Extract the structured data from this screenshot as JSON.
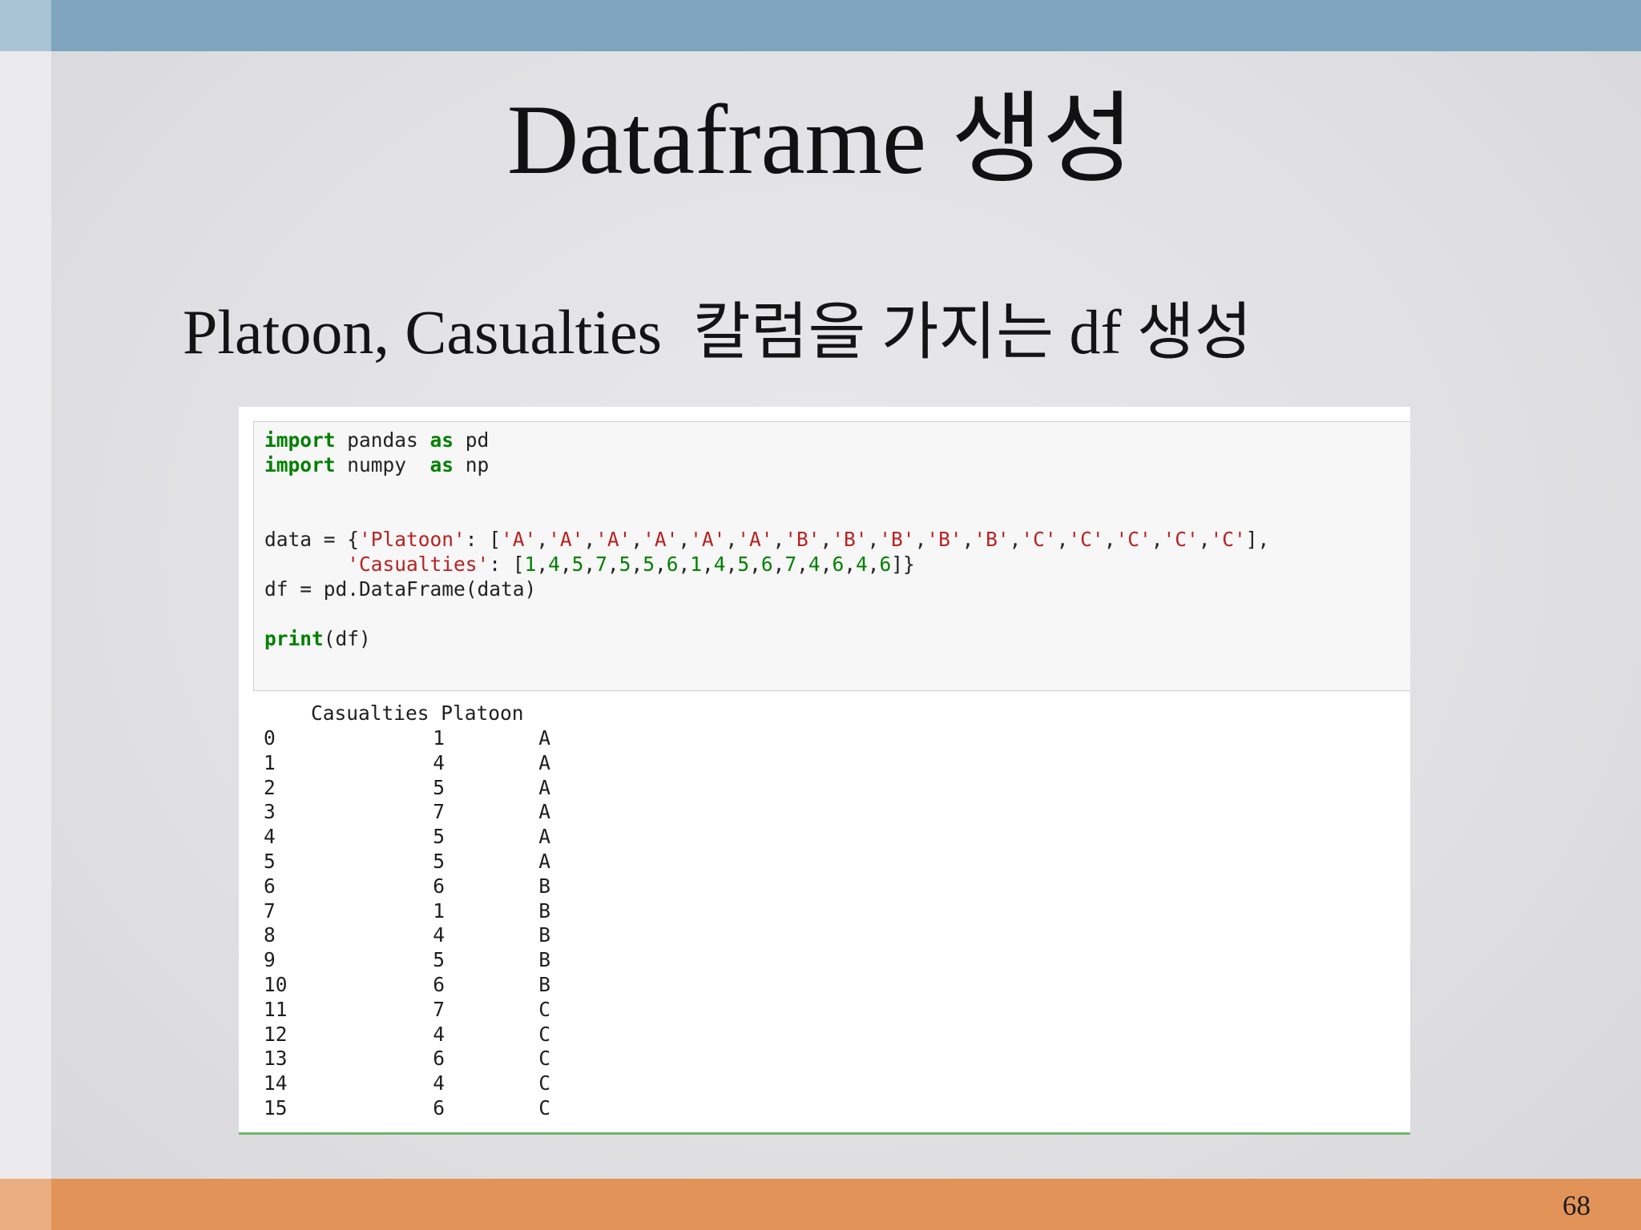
{
  "slide": {
    "title": "Dataframe 생성",
    "subtitle": "Platoon, Casualties  칼럼을 가지는 df 생성",
    "page_number": "68"
  },
  "code": {
    "line1": {
      "kw": "import",
      "rest": " pandas ",
      "kw2": "as",
      "rest2": " pd"
    },
    "line2": {
      "kw": "import",
      "rest": " numpy  ",
      "kw2": "as",
      "rest2": " np"
    },
    "line3": {
      "prefix": "data = {",
      "key": "'Platoon'",
      "sep": ": [",
      "values": [
        "'A'",
        "'A'",
        "'A'",
        "'A'",
        "'A'",
        "'A'",
        "'B'",
        "'B'",
        "'B'",
        "'B'",
        "'B'",
        "'C'",
        "'C'",
        "'C'",
        "'C'",
        "'C'"
      ],
      "suffix": "],"
    },
    "line4": {
      "indent": "       ",
      "key": "'Casualties'",
      "sep": ": [",
      "values": [
        "1",
        "4",
        "5",
        "7",
        "5",
        "5",
        "6",
        "1",
        "4",
        "5",
        "6",
        "7",
        "4",
        "6",
        "4",
        "6"
      ],
      "suffix": "]}"
    },
    "line5": "df = pd.DataFrame(data)",
    "line6": {
      "kw": "print",
      "rest": "(df)"
    }
  },
  "output": {
    "header": "    Casualties Platoon",
    "rows": [
      {
        "index": "0",
        "casualties": "1",
        "platoon": "A"
      },
      {
        "index": "1",
        "casualties": "4",
        "platoon": "A"
      },
      {
        "index": "2",
        "casualties": "5",
        "platoon": "A"
      },
      {
        "index": "3",
        "casualties": "7",
        "platoon": "A"
      },
      {
        "index": "4",
        "casualties": "5",
        "platoon": "A"
      },
      {
        "index": "5",
        "casualties": "5",
        "platoon": "A"
      },
      {
        "index": "6",
        "casualties": "6",
        "platoon": "B"
      },
      {
        "index": "7",
        "casualties": "1",
        "platoon": "B"
      },
      {
        "index": "8",
        "casualties": "4",
        "platoon": "B"
      },
      {
        "index": "9",
        "casualties": "5",
        "platoon": "B"
      },
      {
        "index": "10",
        "casualties": "6",
        "platoon": "B"
      },
      {
        "index": "11",
        "casualties": "7",
        "platoon": "C"
      },
      {
        "index": "12",
        "casualties": "4",
        "platoon": "C"
      },
      {
        "index": "13",
        "casualties": "6",
        "platoon": "C"
      },
      {
        "index": "14",
        "casualties": "4",
        "platoon": "C"
      },
      {
        "index": "15",
        "casualties": "6",
        "platoon": "C"
      }
    ]
  },
  "colors": {
    "top_bar": "#7ea5bd",
    "bottom_bar": "#e29358",
    "code_keyword": "#008000",
    "code_string": "#ba2121",
    "code_number": "#008000",
    "cell_border": "#6fb56e"
  }
}
